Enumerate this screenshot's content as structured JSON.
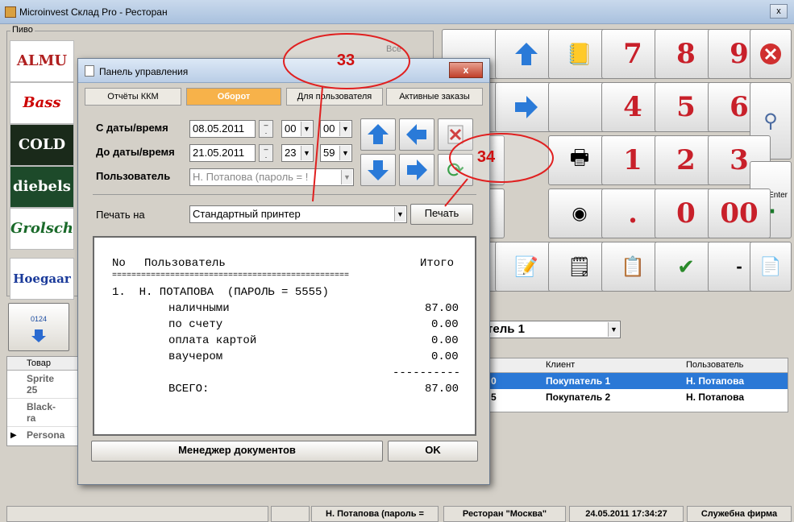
{
  "window": {
    "title": "Microinvest Склад Pro - Ресторан",
    "close": "x"
  },
  "group": {
    "label": "Пиво",
    "all": "Все"
  },
  "beers": [
    "ALMU",
    "Bass",
    "COLD",
    "diebels",
    "Grolsch",
    "Hoegaar"
  ],
  "numpad": {
    "keys": [
      "7",
      "8",
      "9",
      "4",
      "5",
      "6",
      "1",
      "2",
      "3",
      ".",
      "0",
      "00",
      "-"
    ],
    "enter": "Enter"
  },
  "customer": {
    "selected": "тель 1"
  },
  "orders": {
    "headers": [
      "Клиент",
      "Пользователь"
    ],
    "rows": [
      {
        "n": "0",
        "client": "Покупатель 1",
        "user": "Н. Потапова"
      },
      {
        "n": "5",
        "client": "Покупатель 2",
        "user": "Н. Потапова"
      }
    ]
  },
  "items": {
    "header": "Товар",
    "rows": [
      "Sprite 25",
      "Black-ra",
      "Persona"
    ],
    "code_icon": "0124"
  },
  "dialog": {
    "title": "Панель управления",
    "close": "x",
    "tabs": [
      "Отчёты ККМ",
      "Оборот",
      "Для пользователя",
      "Активные заказы"
    ],
    "from_label": "С даты/время",
    "from_date": "08.05.2011",
    "from_h": "00",
    "from_m": "00",
    "to_label": "До даты/время",
    "to_date": "21.05.2011",
    "to_h": "23",
    "to_m": "59",
    "user_label": "Пользователь",
    "user_value": "Н. Потапова (пароль = !",
    "print_label": "Печать на",
    "printer": "Стандартный принтер",
    "print_button": "Печать",
    "report": {
      "h_no": "No",
      "h_user": "Пользователь",
      "h_total": "Итого",
      "sep": "=================================================",
      "row": "1.  Н. ПОТАПОВА  (ПАРОЛЬ = 5555)",
      "lines": [
        {
          "label": "наличными",
          "value": "87.00"
        },
        {
          "label": "по счету",
          "value": "0.00"
        },
        {
          "label": "оплата картой",
          "value": "0.00"
        },
        {
          "label": "ваучером",
          "value": "0.00"
        }
      ],
      "dash": "----------",
      "total_label": "ВСЕГО:",
      "total_value": "87.00"
    },
    "doc_manager": "Менеджер документов",
    "ok": "OK"
  },
  "callouts": [
    "33",
    "34"
  ],
  "statusbar": [
    "Н. Потапова  (пароль =",
    "Ресторан \"Москва\"",
    "24.05.2011 17:34:27",
    "Служебна фирма"
  ]
}
